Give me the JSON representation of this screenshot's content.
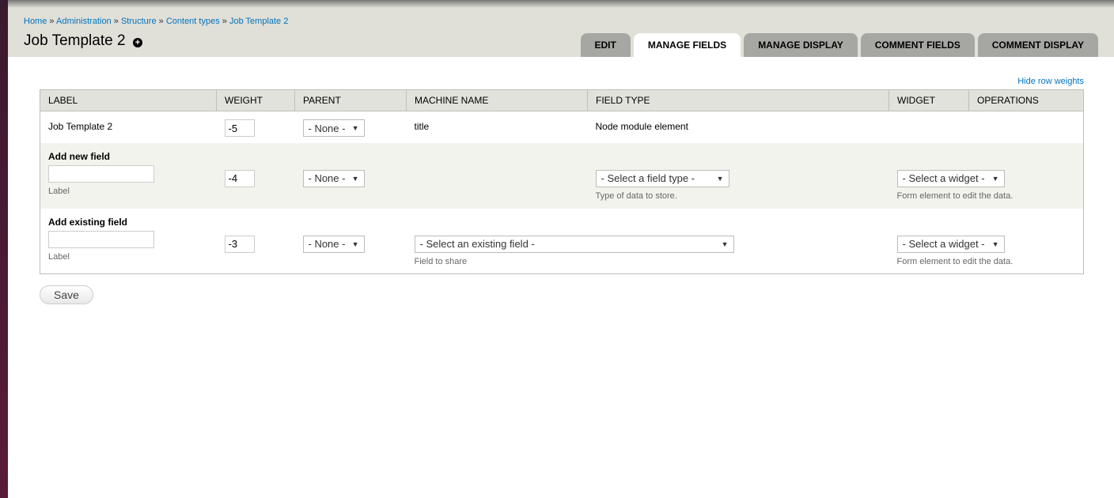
{
  "breadcrumb": [
    "Home",
    "Administration",
    "Structure",
    "Content types",
    "Job Template 2"
  ],
  "separator": "»",
  "page_title": "Job Template 2",
  "tabs": [
    {
      "label": "EDIT"
    },
    {
      "label": "MANAGE FIELDS",
      "active": true
    },
    {
      "label": "MANAGE DISPLAY"
    },
    {
      "label": "COMMENT FIELDS"
    },
    {
      "label": "COMMENT DISPLAY"
    }
  ],
  "hide_weights": "Hide row weights",
  "columns": [
    "LABEL",
    "WEIGHT",
    "PARENT",
    "MACHINE NAME",
    "FIELD TYPE",
    "WIDGET",
    "OPERATIONS"
  ],
  "row1": {
    "label": "Job Template 2",
    "weight": "-5",
    "parent": "- None -",
    "machine": "title",
    "type": "Node module element"
  },
  "new_field": {
    "heading": "Add new field",
    "label_desc": "Label",
    "weight": "-4",
    "parent": "- None -",
    "type": "- Select a field type -",
    "type_desc": "Type of data to store.",
    "widget": "- Select a widget -",
    "widget_desc": "Form element to edit the data."
  },
  "existing_field": {
    "heading": "Add existing field",
    "label_desc": "Label",
    "weight": "-3",
    "parent": "- None -",
    "field": "- Select an existing field -",
    "field_desc": "Field to share",
    "widget": "- Select a widget -",
    "widget_desc": "Form element to edit the data."
  },
  "save": "Save",
  "colors": {
    "link": "#0074bd",
    "header_bg": "#e0dfd8",
    "tab_bg": "#a6a7a2"
  }
}
